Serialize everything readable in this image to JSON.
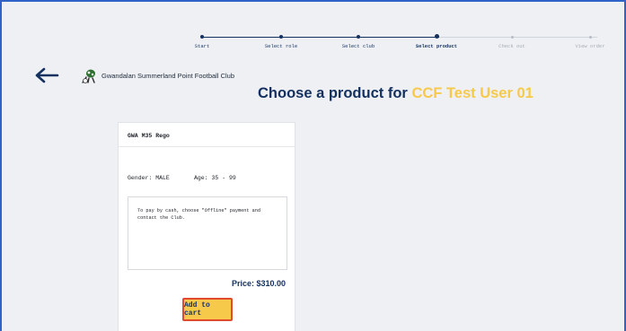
{
  "stepper": {
    "steps": [
      {
        "label": "Start",
        "state": "done"
      },
      {
        "label": "Select role",
        "state": "done"
      },
      {
        "label": "Select club",
        "state": "done"
      },
      {
        "label": "Select product",
        "state": "active"
      },
      {
        "label": "Check out",
        "state": "future"
      },
      {
        "label": "View order",
        "state": "future"
      }
    ]
  },
  "header": {
    "back_icon": "arrow-left-icon",
    "club_name": "Gwandalan Summerland Point Football Club",
    "title_prefix": "Choose a product for",
    "user_name": "CCF Test User 01"
  },
  "product": {
    "name": "GWA M35 Rego",
    "gender": "Gender: MALE",
    "age": "Age: 35 - 99",
    "notice": "To pay by cash, choose \"Offline\" payment and contact the Club.",
    "price": "Price: $310.00",
    "add_to_cart_label": "Add to cart"
  },
  "colors": {
    "navy": "#13305f",
    "accent_yellow": "#f7c94b",
    "future_grey": "#b7bcc6",
    "frame_blue": "#2f63c9"
  }
}
